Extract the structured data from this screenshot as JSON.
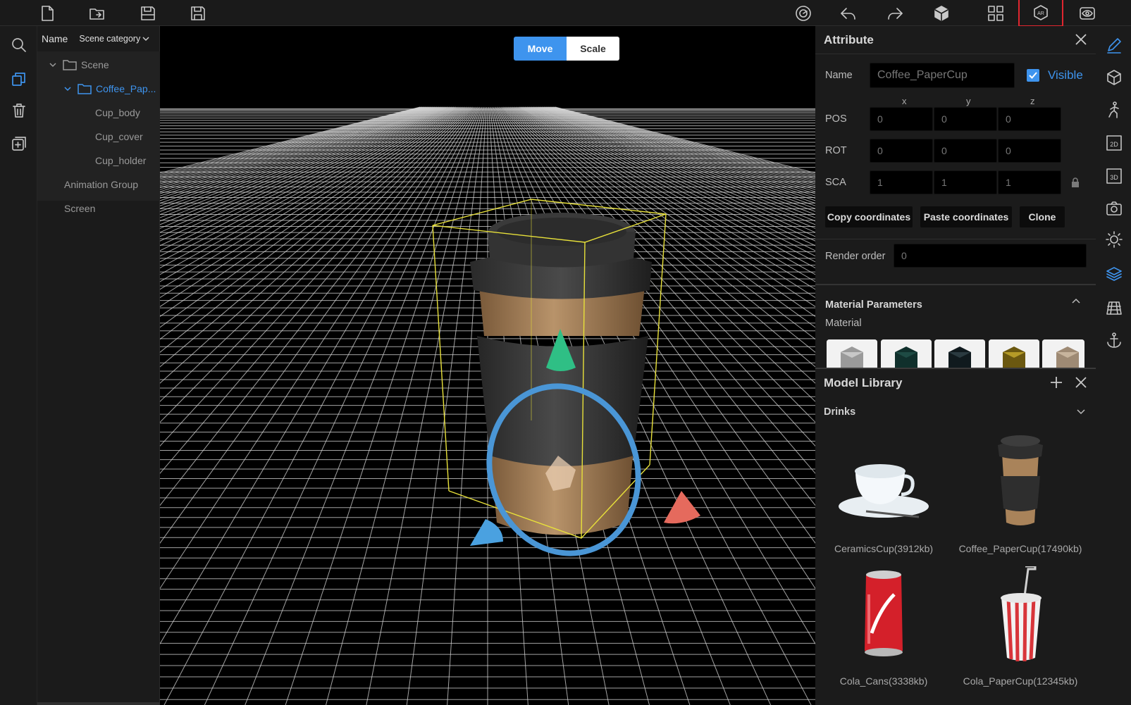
{
  "toolbar": {
    "left_icons": [
      "new-file-icon",
      "open-folder-icon",
      "save-icon",
      "save-as-icon"
    ],
    "right_icons": [
      "target-icon",
      "undo-icon",
      "redo-icon",
      "cube-icon",
      "grid-icon",
      "ar-icon",
      "eye-icon"
    ],
    "ar_label": "AR",
    "ar_highlight_color": "#e0262f"
  },
  "rail": {
    "icons": [
      "search-icon",
      "layers-icon",
      "trash-icon",
      "add-icon"
    ],
    "active_color": "#3e94ee"
  },
  "tree": {
    "col_name": "Name",
    "col_category": "Scene category",
    "items": [
      {
        "label": "Scene"
      },
      {
        "label": "Coffee_Pap..."
      },
      {
        "label": "Cup_body"
      },
      {
        "label": "Cup_cover"
      },
      {
        "label": "Cup_holder"
      },
      {
        "label": "Animation Group"
      },
      {
        "label": "Screen"
      }
    ]
  },
  "viewport": {
    "mode_move": "Move",
    "mode_scale": "Scale",
    "accent": "#3e94ee"
  },
  "attribute": {
    "title": "Attribute",
    "name_label": "Name",
    "name_value": "Coffee_PaperCup",
    "visible_label": "Visible",
    "axes": [
      "x",
      "y",
      "z"
    ],
    "pos_label": "POS",
    "pos": [
      "0",
      "0",
      "0"
    ],
    "rot_label": "ROT",
    "rot": [
      "0",
      "0",
      "0"
    ],
    "sca_label": "SCA",
    "sca": [
      "1",
      "1",
      "1"
    ],
    "copy_btn": "Copy coordinates",
    "paste_btn": "Paste coordinates",
    "clone_btn": "Clone",
    "render_order_label": "Render order",
    "render_order": "0",
    "material_params": "Material Parameters",
    "material_label": "Material"
  },
  "right_rail": {
    "icons": [
      "pencil-icon",
      "box-icon",
      "figure-icon",
      "2d-icon",
      "3d-icon",
      "camera-icon",
      "light-icon",
      "layers-stack-icon",
      "mesh-icon",
      "anchor-icon"
    ],
    "label_2d": "2D",
    "label_3d": "3D"
  },
  "library": {
    "title": "Model Library",
    "category": "Drinks",
    "items": [
      {
        "name": "CeramicsCup(3912kb)"
      },
      {
        "name": "Coffee_PaperCup(17490kb)"
      },
      {
        "name": "Cola_Cans(3338kb)"
      },
      {
        "name": "Cola_PaperCup(12345kb)"
      }
    ]
  }
}
